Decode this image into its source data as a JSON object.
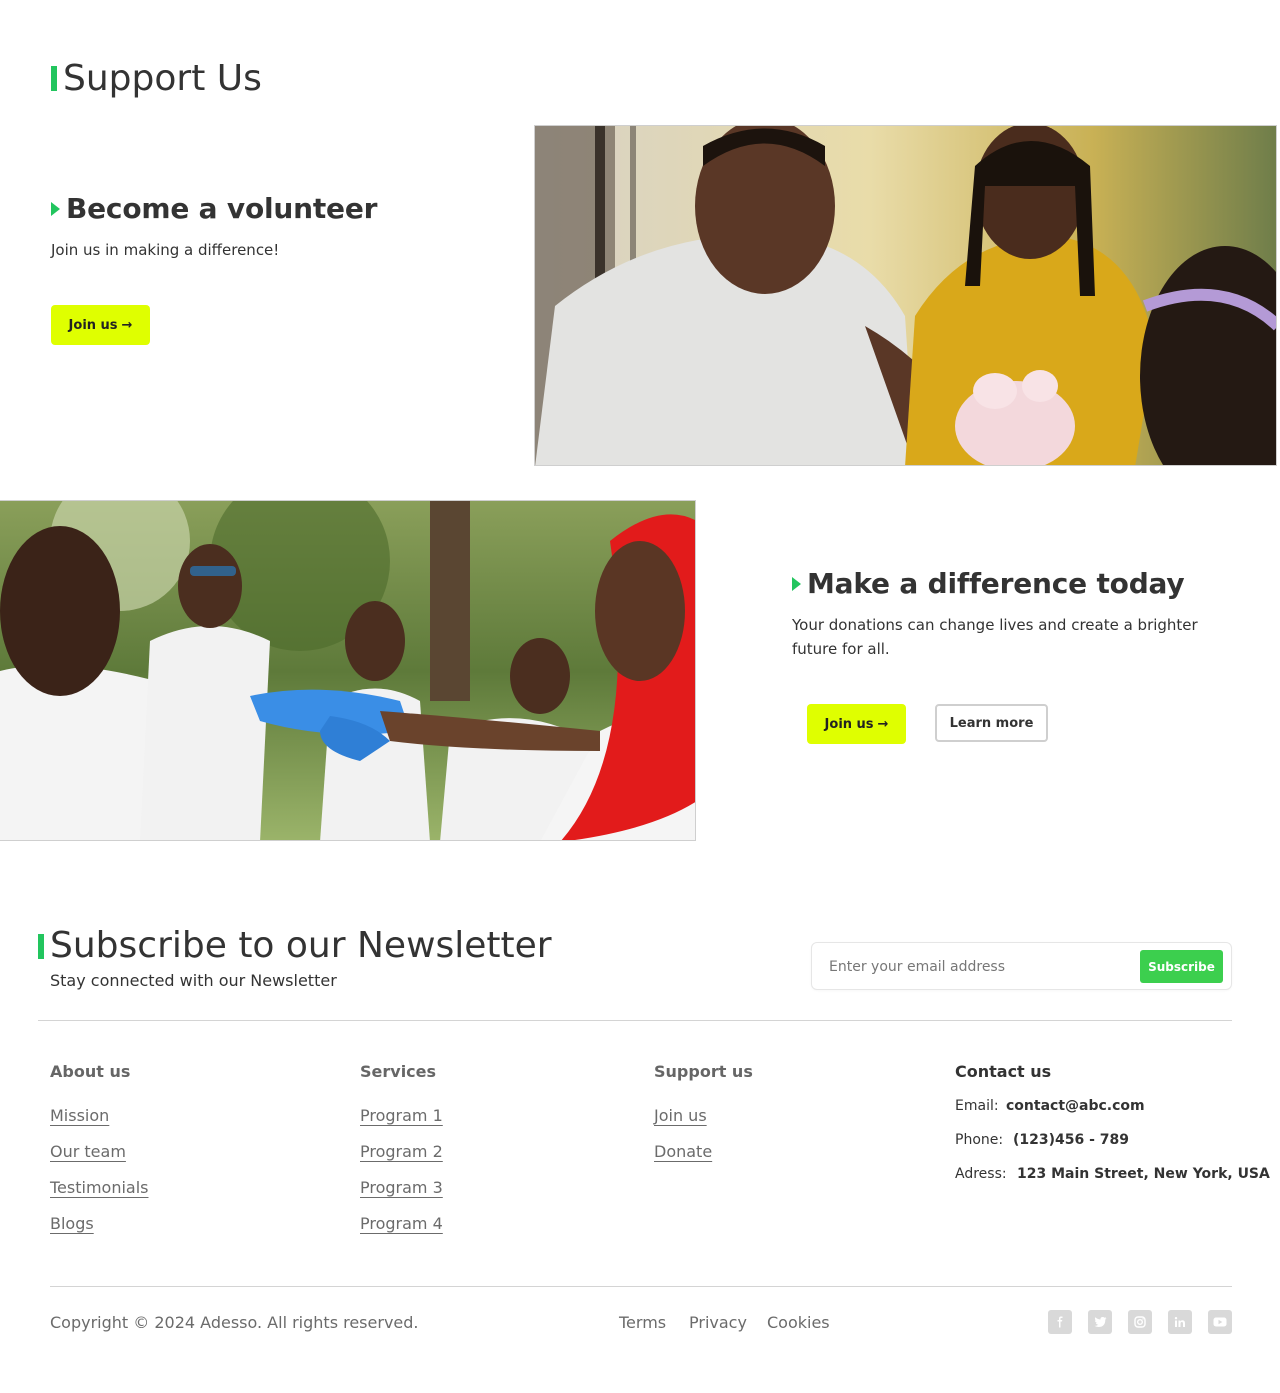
{
  "support": {
    "title": "Support Us",
    "volunteer": {
      "title": "Become a volunteer",
      "description": "Join us in making a difference!",
      "join_label": "Join us",
      "arrow": "→"
    },
    "difference": {
      "title": "Make a difference today",
      "description": "Your donations can change lives and create a brighter future for all.",
      "join_label": "Join us",
      "arrow": "→",
      "learn_label": "Learn more"
    }
  },
  "newsletter": {
    "title": "Subscribe to our Newsletter",
    "description": "Stay connected with our Newsletter",
    "placeholder": "Enter your email address",
    "button_label": "Subscribe"
  },
  "footer": {
    "about": {
      "heading": "About us",
      "links": [
        "Mission",
        "Our team",
        "Testimonials",
        "Blogs"
      ]
    },
    "services": {
      "heading": "Services",
      "links": [
        "Program 1",
        "Program 2",
        "Program 3",
        "Program 4"
      ]
    },
    "support": {
      "heading": "Support us",
      "links": [
        "Join us",
        "Donate"
      ]
    },
    "contact": {
      "heading": "Contact us",
      "email_label": "Email:",
      "email": "contact@abc.com",
      "phone_label": "Phone:",
      "phone": "(123)456 - 789",
      "address_label": "Adress:",
      "address": "123 Main Street, New York, USA"
    },
    "copyright": "Copyright © 2024 Adesso. All rights reserved.",
    "legal": [
      "Terms",
      "Privacy",
      "Cookies"
    ],
    "social_icons": [
      "facebook-icon",
      "twitter-icon",
      "instagram-icon",
      "linkedin-icon",
      "youtube-icon"
    ]
  },
  "colors": {
    "accent_green": "#22c55e",
    "button_yellow": "#dfff00",
    "subscribe_green": "#3ccf4e",
    "text_dark": "#333333",
    "text_muted": "#6b6b6b"
  }
}
